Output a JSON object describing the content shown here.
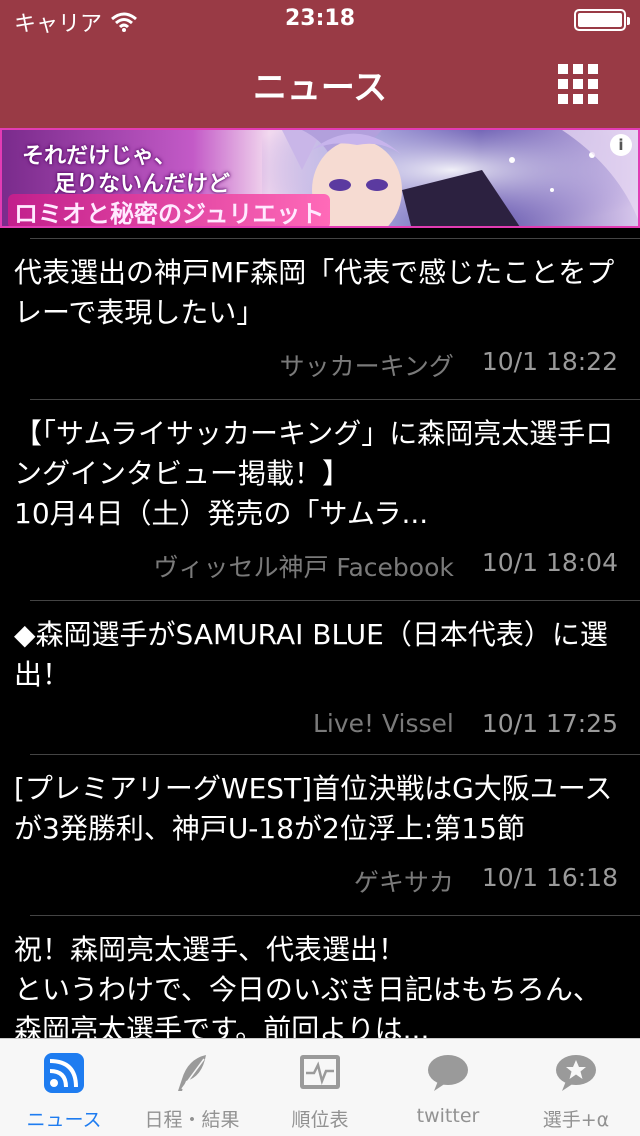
{
  "status": {
    "carrier": "キャリア",
    "time": "23:18"
  },
  "nav": {
    "title": "ニュース",
    "grid_icon": "grid-icon"
  },
  "ad": {
    "line1": "それだけじゃ、",
    "line2": "足りないんだけど",
    "line3": "ロミオと秘密のジュリエット",
    "info": "i"
  },
  "news": [
    {
      "title": "代表選出の神戸MF森岡「代表で感じたことをプレーで表現したい」",
      "source": "サッカーキング",
      "date": "10/1 18:22"
    },
    {
      "title": "【「サムライサッカーキング」に森岡亮太選手ロングインタビュー掲載！】\n10月4日（土）発売の「サムラ...",
      "source": "ヴィッセル神戸 Facebook",
      "date": "10/1 18:04"
    },
    {
      "title": "◆森岡選手がSAMURAI BLUE（日本代表）に選出！",
      "source": "Live! Vissel",
      "date": "10/1 17:25"
    },
    {
      "title": "[プレミアリーグWEST]首位決戦はG大阪ユースが3発勝利、神戸U-18が2位浮上:第15節",
      "source": "ゲキサカ",
      "date": "10/1 16:18"
    },
    {
      "title": "祝！森岡亮太選手、代表選出！\nというわけで、今日のいぶき日記はもちろん、森岡亮太選手です。前回よりは...",
      "source": "",
      "date": ""
    }
  ],
  "tabs": [
    {
      "label": "ニュース",
      "icon": "rss-icon",
      "active": true
    },
    {
      "label": "日程・結果",
      "icon": "feather-icon",
      "active": false
    },
    {
      "label": "順位表",
      "icon": "chart-monitor-icon",
      "active": false
    },
    {
      "label": "twitter",
      "icon": "speech-bubble-icon",
      "active": false
    },
    {
      "label": "選手+α",
      "icon": "star-bubble-icon",
      "active": false
    }
  ],
  "colors": {
    "nav_bg": "#993a45",
    "tab_active": "#1e7cf0",
    "tab_inactive": "#929292"
  }
}
